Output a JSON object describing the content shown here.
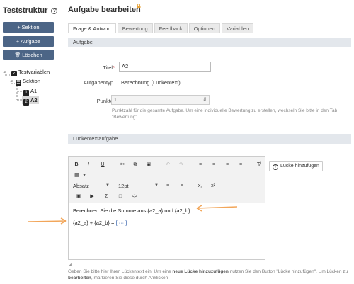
{
  "left": {
    "title": "Teststruktur",
    "buttons": [
      {
        "label": "Sektion",
        "icon": "plus-icon"
      },
      {
        "label": "Aufgabe",
        "icon": "plus-icon"
      },
      {
        "label": "Löschen",
        "icon": "trash-icon"
      }
    ],
    "tree": {
      "root": "Testvariablen",
      "section": "Sektion",
      "items": [
        {
          "label": "A1",
          "badge": "1"
        },
        {
          "label": "A2",
          "badge": "2",
          "selected": true
        }
      ]
    }
  },
  "main": {
    "title": "Aufgabe bearbeiten",
    "tabs": [
      "Frage & Antwort",
      "Bewertung",
      "Feedback",
      "Optionen",
      "Variablen"
    ],
    "active_tab": "Frage & Antwort",
    "section_task": "Aufgabe",
    "fields": {
      "title_label": "Titel",
      "title_required": "*",
      "title_value": "A2",
      "type_label": "Aufgabentyp",
      "type_value": "Berechnung (Lückentext)",
      "points_label": "Punkte",
      "points_value": "1",
      "points_hint": "Punktzahl für die gesamte Aufgabe. Um eine individuelle Bewertung zu erstellen, wechseln Sie bitte in den Tab \"Bewertung\"."
    },
    "section_gap": "Lückentextaufgabe",
    "editor": {
      "format_select": "Absatz",
      "size_select": "12pt",
      "content_line1": "Berechnen Sie die Summe aus {a2_a} und {a2_b}",
      "content_line2_prefix": "{a2_a} + {a2_b} = ",
      "content_gap": "[ ··· ]"
    },
    "add_gap_button": "Lücke hinzufügen",
    "footer_hint_1": "Geben Sie bitte hier Ihren Lückentext ein. Um eine ",
    "footer_hint_bold_1": "neue Lücke hinzuzufügen",
    "footer_hint_2": " nutzen Sie den Button \"Lücke hinzufügen\". Um Lücken zu ",
    "footer_hint_bold_2": "bearbeiten",
    "footer_hint_3": ", markieren Sie diese durch Anklicken"
  },
  "colors": {
    "button_bg": "#4c6586",
    "section_bg": "#e3e7ec",
    "arrow": "#f2a65a",
    "lock": "#e8a33a"
  }
}
